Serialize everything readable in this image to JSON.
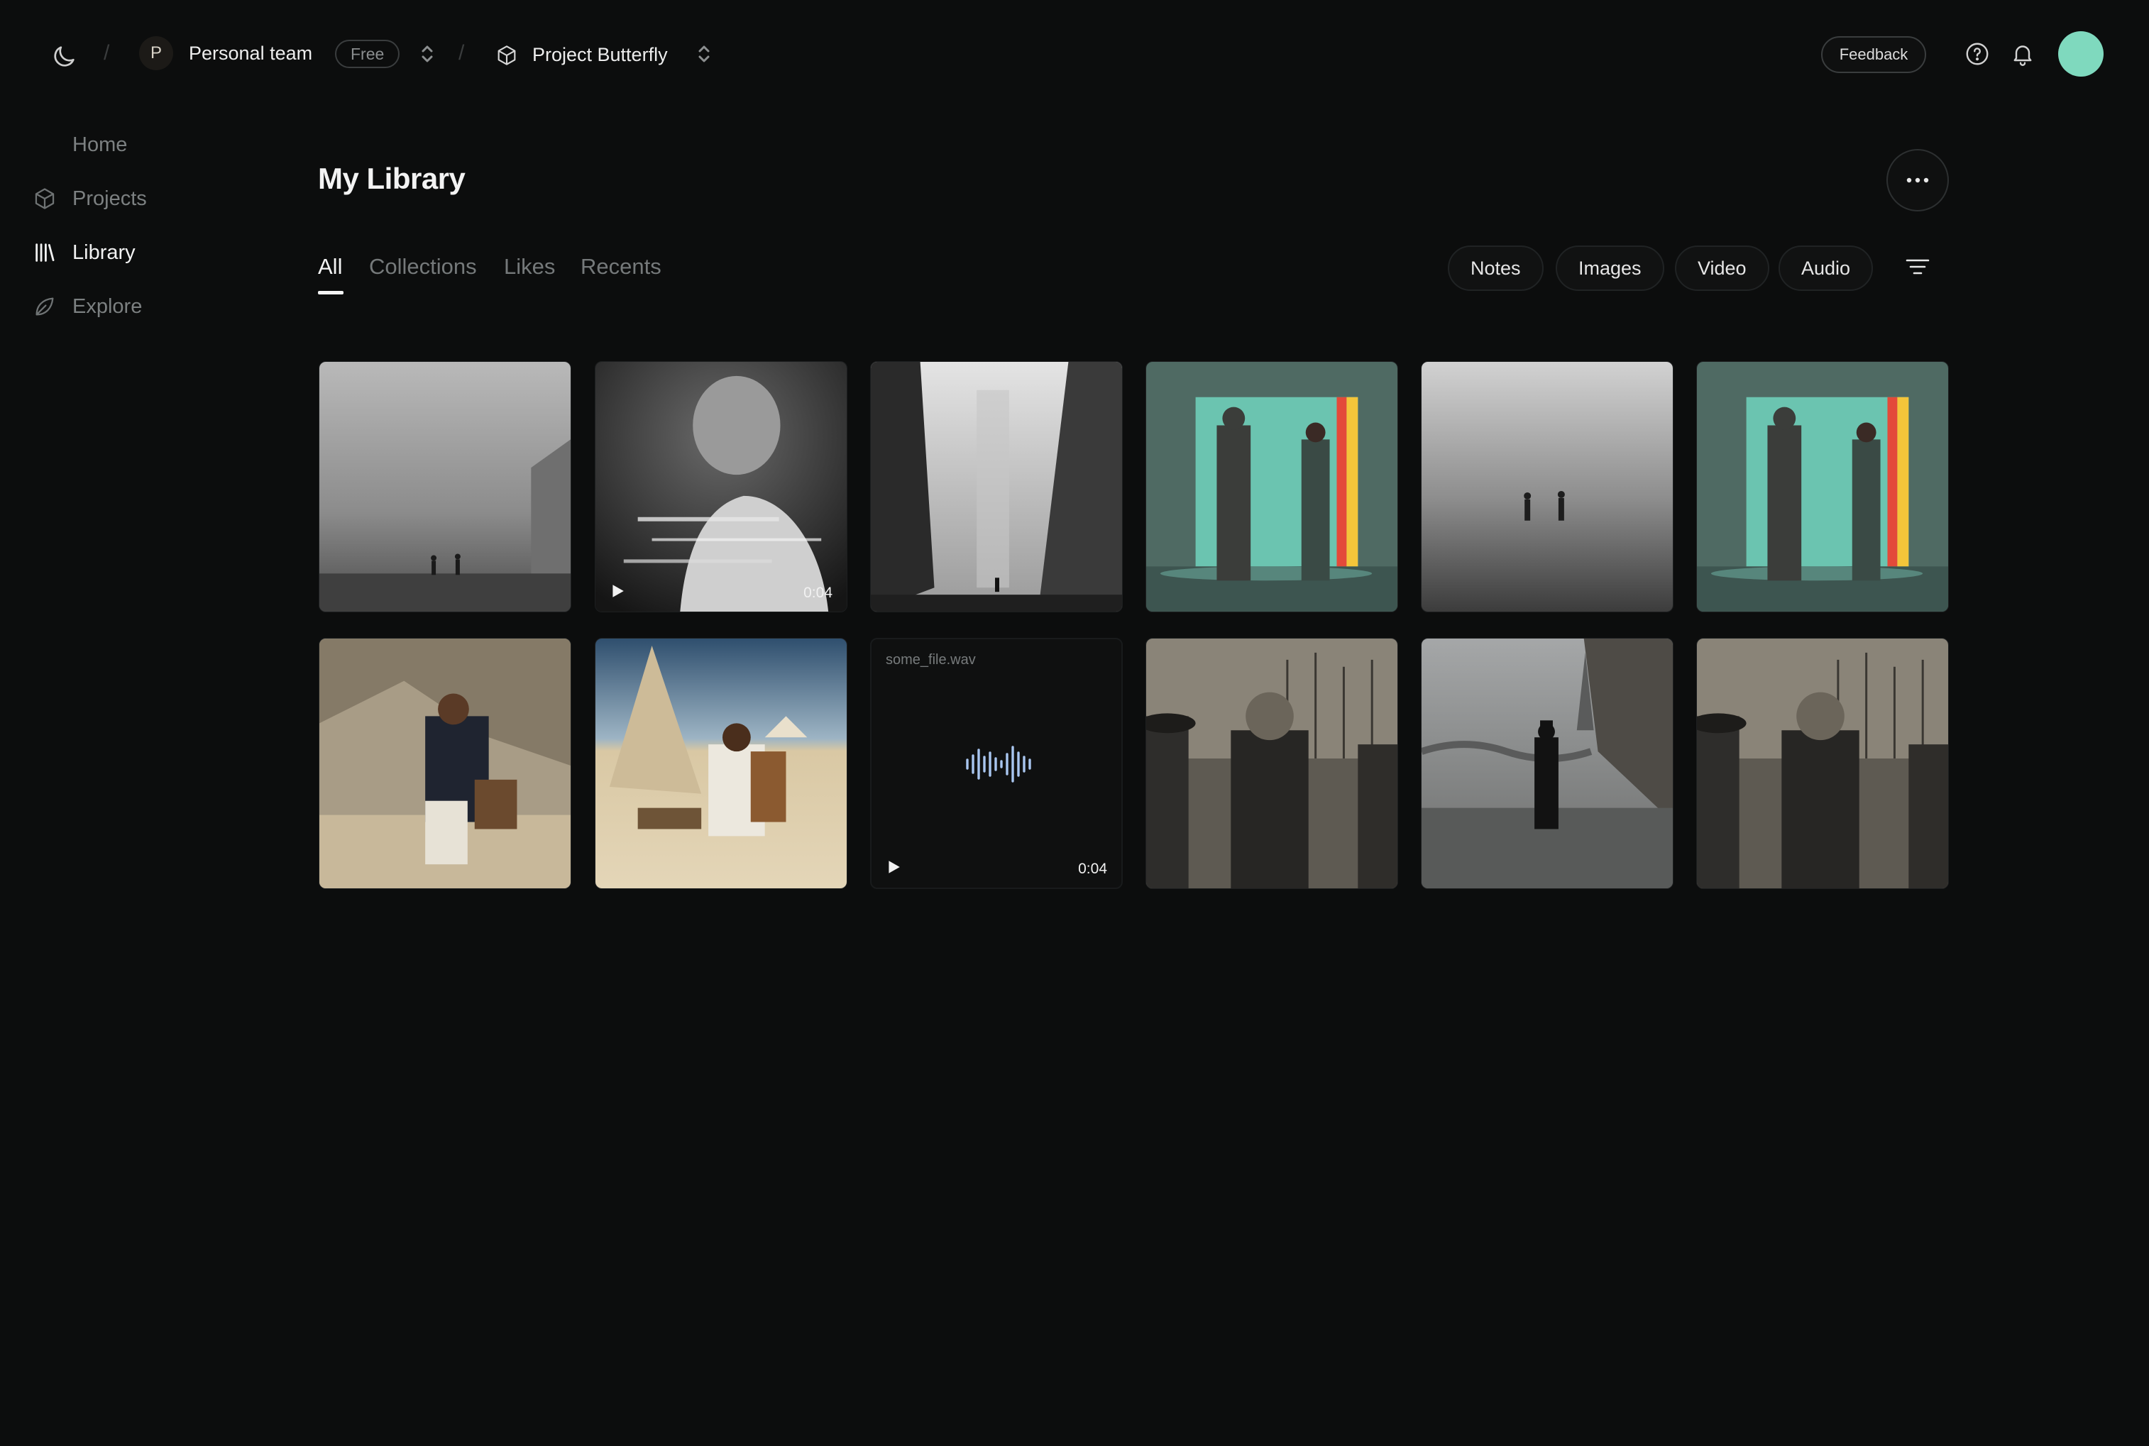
{
  "topbar": {
    "team_initial": "P",
    "team_name": "Personal team",
    "plan_badge": "Free",
    "project_name": "Project Butterfly",
    "feedback_label": "Feedback"
  },
  "sidebar": {
    "items": [
      {
        "label": "Home",
        "icon": "none"
      },
      {
        "label": "Projects",
        "icon": "cube-icon"
      },
      {
        "label": "Library",
        "icon": "library-icon",
        "active": true
      },
      {
        "label": "Explore",
        "icon": "leaf-icon"
      }
    ]
  },
  "main": {
    "title": "My Library",
    "tabs": [
      {
        "label": "All",
        "active": true
      },
      {
        "label": "Collections"
      },
      {
        "label": "Likes"
      },
      {
        "label": "Recents"
      }
    ],
    "filters": [
      "Notes",
      "Images",
      "Video",
      "Audio"
    ]
  },
  "grid": {
    "items": [
      {
        "kind": "image",
        "subject": "foggy plaza, two figures shaking hands"
      },
      {
        "kind": "video",
        "subject": "glitched bald man portrait",
        "duration": "0:04"
      },
      {
        "kind": "image",
        "subject": "lone figure between tall buildings in fog"
      },
      {
        "kind": "image",
        "subject": "two figures shaking hands in teal frame"
      },
      {
        "kind": "image",
        "subject": "two figures shaking hands in fog"
      },
      {
        "kind": "image",
        "subject": "two figures shaking hands in teal frame"
      },
      {
        "kind": "image",
        "subject": "soldier reading in tent"
      },
      {
        "kind": "image",
        "subject": "officer seated in desert camp"
      },
      {
        "kind": "audio",
        "file_name": "some_file.wav",
        "duration": "0:04"
      },
      {
        "kind": "image",
        "subject": "officer at harbor, sepia"
      },
      {
        "kind": "image",
        "subject": "man walking wet street near Eiffel Tower"
      },
      {
        "kind": "image",
        "subject": "officer at harbor, sepia"
      }
    ]
  },
  "colors": {
    "background": "#0c0d0d",
    "avatar": "#7fd9be",
    "wave": "#a9c6f0"
  }
}
